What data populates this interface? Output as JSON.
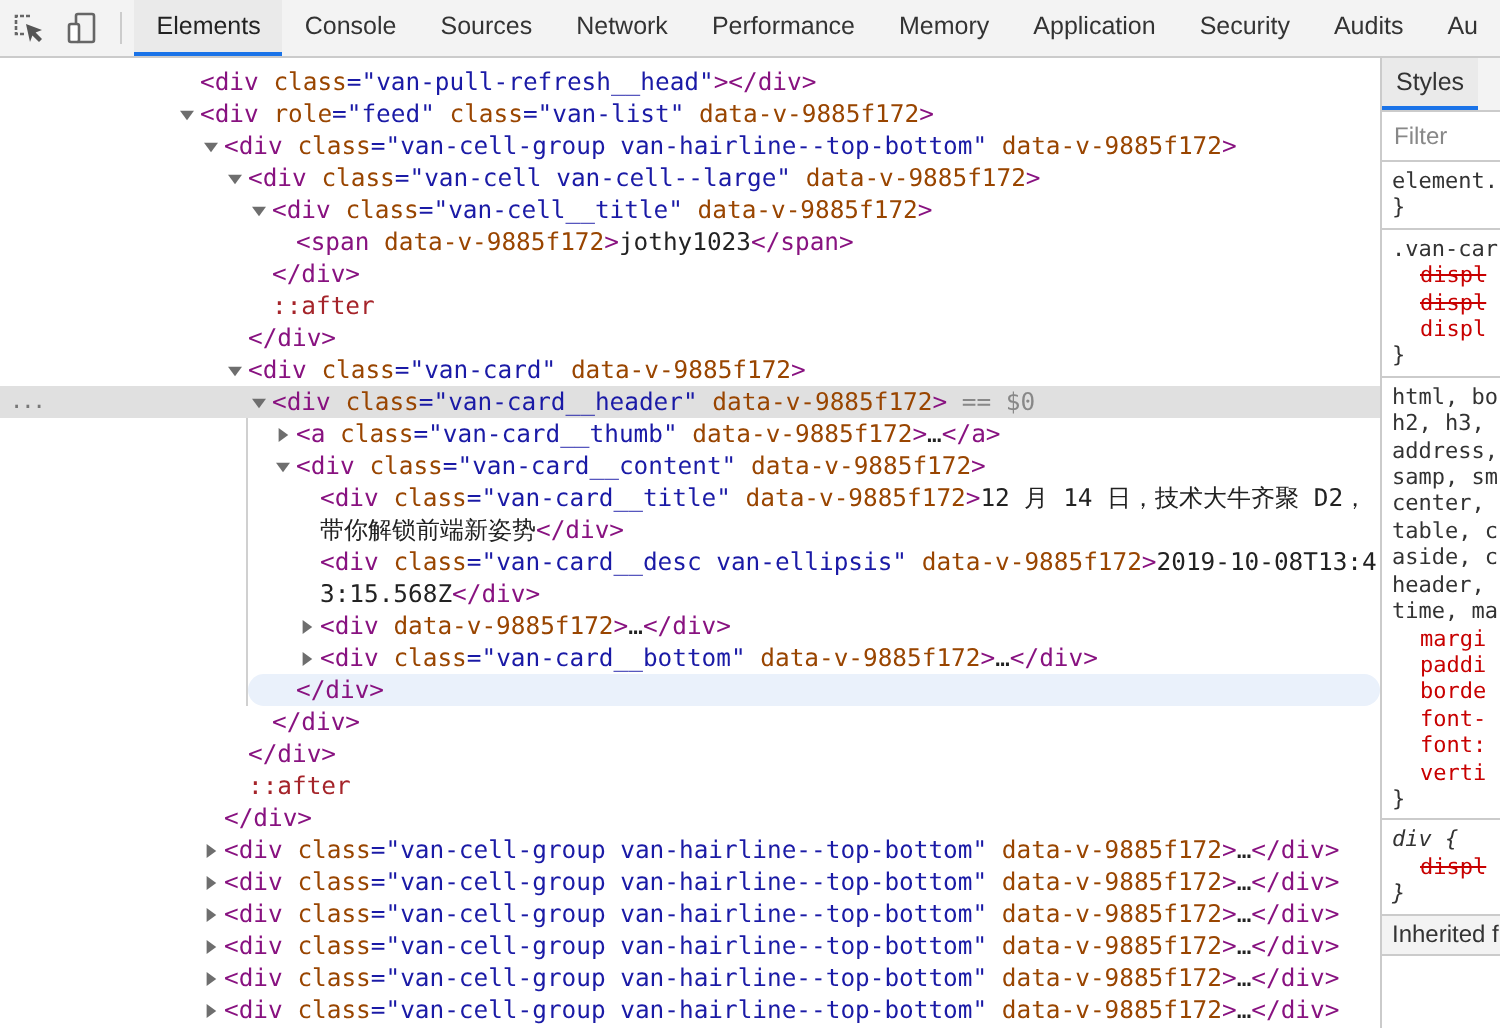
{
  "toolbar": {
    "tabs": [
      {
        "label": "Elements",
        "selected": true
      },
      {
        "label": "Console",
        "selected": false
      },
      {
        "label": "Sources",
        "selected": false
      },
      {
        "label": "Network",
        "selected": false
      },
      {
        "label": "Performance",
        "selected": false
      },
      {
        "label": "Memory",
        "selected": false
      },
      {
        "label": "Application",
        "selected": false
      },
      {
        "label": "Security",
        "selected": false
      },
      {
        "label": "Audits",
        "selected": false
      },
      {
        "label": "Au",
        "selected": false
      }
    ]
  },
  "elements": {
    "selected_marker": "...",
    "selected_suffix": " == $0",
    "nodes": [
      {
        "selected": false,
        "line": [
          {
            "kind": "tag",
            "text": "<div"
          },
          {
            "kind": "attr",
            "text": " class"
          },
          {
            "kind": "val",
            "text": "=\"van-pull-refresh__head\""
          },
          {
            "kind": "tag",
            "text": "></div>"
          }
        ]
      },
      {
        "selected": false,
        "expanded": true,
        "line": [
          {
            "kind": "tag",
            "text": "<div"
          },
          {
            "kind": "attr",
            "text": " role"
          },
          {
            "kind": "val",
            "text": "=\"feed\""
          },
          {
            "kind": "attr",
            "text": " class"
          },
          {
            "kind": "val",
            "text": "=\"van-list\""
          },
          {
            "kind": "attr",
            "text": " data-v-9885f172"
          },
          {
            "kind": "tag",
            "text": ">"
          }
        ],
        "children": [
          {
            "selected": false,
            "expanded": true,
            "line": [
              {
                "kind": "tag",
                "text": "<div"
              },
              {
                "kind": "attr",
                "text": " class"
              },
              {
                "kind": "val",
                "text": "=\"van-cell-group van-hairline--top-bottom\""
              },
              {
                "kind": "attr",
                "text": " data-v-9885f172"
              },
              {
                "kind": "tag",
                "text": ">"
              }
            ],
            "children": [
              {
                "selected": false,
                "expanded": true,
                "line": [
                  {
                    "kind": "tag",
                    "text": "<div"
                  },
                  {
                    "kind": "attr",
                    "text": " class"
                  },
                  {
                    "kind": "val",
                    "text": "=\"van-cell van-cell--large\""
                  },
                  {
                    "kind": "attr",
                    "text": " data-v-9885f172"
                  },
                  {
                    "kind": "tag",
                    "text": ">"
                  }
                ],
                "children": [
                  {
                    "selected": false,
                    "expanded": true,
                    "line": [
                      {
                        "kind": "tag",
                        "text": "<div"
                      },
                      {
                        "kind": "attr",
                        "text": " class"
                      },
                      {
                        "kind": "val",
                        "text": "=\"van-cell__title\""
                      },
                      {
                        "kind": "attr",
                        "text": " data-v-9885f172"
                      },
                      {
                        "kind": "tag",
                        "text": ">"
                      }
                    ],
                    "children": [
                      {
                        "selected": false,
                        "line": [
                          {
                            "kind": "tag",
                            "text": "<span"
                          },
                          {
                            "kind": "attr",
                            "text": " data-v-9885f172"
                          },
                          {
                            "kind": "tag",
                            "text": ">"
                          },
                          {
                            "kind": "text",
                            "text": "jothy1023"
                          },
                          {
                            "kind": "tag",
                            "text": "</span>"
                          }
                        ]
                      }
                    ],
                    "close": {
                      "hovered": false,
                      "line": [
                        {
                          "kind": "tag",
                          "text": "</div>"
                        }
                      ]
                    }
                  },
                  {
                    "selected": false,
                    "line": [
                      {
                        "kind": "pseudo",
                        "text": "::after"
                      }
                    ]
                  }
                ],
                "close": {
                  "hovered": false,
                  "line": [
                    {
                      "kind": "tag",
                      "text": "</div>"
                    }
                  ]
                }
              },
              {
                "selected": false,
                "expanded": true,
                "line": [
                  {
                    "kind": "tag",
                    "text": "<div"
                  },
                  {
                    "kind": "attr",
                    "text": " class"
                  },
                  {
                    "kind": "val",
                    "text": "=\"van-card\""
                  },
                  {
                    "kind": "attr",
                    "text": " data-v-9885f172"
                  },
                  {
                    "kind": "tag",
                    "text": ">"
                  }
                ],
                "children": [
                  {
                    "selected": true,
                    "expanded": true,
                    "line": [
                      {
                        "kind": "tag",
                        "text": "<div"
                      },
                      {
                        "kind": "attr",
                        "text": " class"
                      },
                      {
                        "kind": "val",
                        "text": "=\"van-card__header\""
                      },
                      {
                        "kind": "attr",
                        "text": " data-v-9885f172"
                      },
                      {
                        "kind": "tag",
                        "text": ">"
                      }
                    ],
                    "children": [
                      {
                        "selected": false,
                        "expanded": false,
                        "line": [
                          {
                            "kind": "tag",
                            "text": "<a"
                          },
                          {
                            "kind": "attr",
                            "text": " class"
                          },
                          {
                            "kind": "val",
                            "text": "=\"van-card__thumb\""
                          },
                          {
                            "kind": "attr",
                            "text": " data-v-9885f172"
                          },
                          {
                            "kind": "tag",
                            "text": ">"
                          },
                          {
                            "kind": "text",
                            "text": "…"
                          },
                          {
                            "kind": "tag",
                            "text": "</a>"
                          }
                        ]
                      },
                      {
                        "selected": false,
                        "expanded": true,
                        "line": [
                          {
                            "kind": "tag",
                            "text": "<div"
                          },
                          {
                            "kind": "attr",
                            "text": " class"
                          },
                          {
                            "kind": "val",
                            "text": "=\"van-card__content\""
                          },
                          {
                            "kind": "attr",
                            "text": " data-v-9885f172"
                          },
                          {
                            "kind": "tag",
                            "text": ">"
                          }
                        ],
                        "children": [
                          {
                            "selected": false,
                            "line": [
                              {
                                "kind": "tag",
                                "text": "<div"
                              },
                              {
                                "kind": "attr",
                                "text": " class"
                              },
                              {
                                "kind": "val",
                                "text": "=\"van-card__title\""
                              },
                              {
                                "kind": "attr",
                                "text": " data-v-9885f172"
                              },
                              {
                                "kind": "tag",
                                "text": ">"
                              },
                              {
                                "kind": "text",
                                "text": "12 月 14 日，技术大牛齐聚 D2，带你解锁前端新姿势"
                              },
                              {
                                "kind": "tag",
                                "text": "</div>"
                              }
                            ]
                          },
                          {
                            "selected": false,
                            "line": [
                              {
                                "kind": "tag",
                                "text": "<div"
                              },
                              {
                                "kind": "attr",
                                "text": " class"
                              },
                              {
                                "kind": "val",
                                "text": "=\"van-card__desc van-ellipsis\""
                              },
                              {
                                "kind": "attr",
                                "text": " data-v-9885f172"
                              },
                              {
                                "kind": "tag",
                                "text": ">"
                              },
                              {
                                "kind": "text",
                                "text": "2019-10-08T13:43:15.568Z"
                              },
                              {
                                "kind": "tag",
                                "text": "</div>"
                              }
                            ]
                          },
                          {
                            "selected": false,
                            "expanded": false,
                            "line": [
                              {
                                "kind": "tag",
                                "text": "<div"
                              },
                              {
                                "kind": "attr",
                                "text": " data-v-9885f172"
                              },
                              {
                                "kind": "tag",
                                "text": ">"
                              },
                              {
                                "kind": "text",
                                "text": "…"
                              },
                              {
                                "kind": "tag",
                                "text": "</div>"
                              }
                            ]
                          },
                          {
                            "selected": false,
                            "expanded": false,
                            "line": [
                              {
                                "kind": "tag",
                                "text": "<div"
                              },
                              {
                                "kind": "attr",
                                "text": " class"
                              },
                              {
                                "kind": "val",
                                "text": "=\"van-card__bottom\""
                              },
                              {
                                "kind": "attr",
                                "text": " data-v-9885f172"
                              },
                              {
                                "kind": "tag",
                                "text": ">"
                              },
                              {
                                "kind": "text",
                                "text": "…"
                              },
                              {
                                "kind": "tag",
                                "text": "</div>"
                              }
                            ]
                          }
                        ],
                        "close": {
                          "hovered": true,
                          "line": [
                            {
                              "kind": "tag",
                              "text": "</div>"
                            }
                          ]
                        }
                      }
                    ],
                    "close": {
                      "hovered": false,
                      "line": [
                        {
                          "kind": "tag",
                          "text": "</div>"
                        }
                      ]
                    }
                  }
                ],
                "close": {
                  "hovered": false,
                  "line": [
                    {
                      "kind": "tag",
                      "text": "</div>"
                    }
                  ]
                }
              },
              {
                "selected": false,
                "line": [
                  {
                    "kind": "pseudo",
                    "text": "::after"
                  }
                ]
              }
            ],
            "close": {
              "hovered": false,
              "line": [
                {
                  "kind": "tag",
                  "text": "</div>"
                }
              ]
            }
          },
          {
            "selected": false,
            "expanded": false,
            "line": [
              {
                "kind": "tag",
                "text": "<div"
              },
              {
                "kind": "attr",
                "text": " class"
              },
              {
                "kind": "val",
                "text": "=\"van-cell-group van-hairline--top-bottom\""
              },
              {
                "kind": "attr",
                "text": " data-v-9885f172"
              },
              {
                "kind": "tag",
                "text": ">"
              },
              {
                "kind": "text",
                "text": "…"
              },
              {
                "kind": "tag",
                "text": "</div>"
              }
            ]
          },
          {
            "selected": false,
            "expanded": false,
            "line": [
              {
                "kind": "tag",
                "text": "<div"
              },
              {
                "kind": "attr",
                "text": " class"
              },
              {
                "kind": "val",
                "text": "=\"van-cell-group van-hairline--top-bottom\""
              },
              {
                "kind": "attr",
                "text": " data-v-9885f172"
              },
              {
                "kind": "tag",
                "text": ">"
              },
              {
                "kind": "text",
                "text": "…"
              },
              {
                "kind": "tag",
                "text": "</div>"
              }
            ]
          },
          {
            "selected": false,
            "expanded": false,
            "line": [
              {
                "kind": "tag",
                "text": "<div"
              },
              {
                "kind": "attr",
                "text": " class"
              },
              {
                "kind": "val",
                "text": "=\"van-cell-group van-hairline--top-bottom\""
              },
              {
                "kind": "attr",
                "text": " data-v-9885f172"
              },
              {
                "kind": "tag",
                "text": ">"
              },
              {
                "kind": "text",
                "text": "…"
              },
              {
                "kind": "tag",
                "text": "</div>"
              }
            ]
          },
          {
            "selected": false,
            "expanded": false,
            "line": [
              {
                "kind": "tag",
                "text": "<div"
              },
              {
                "kind": "attr",
                "text": " class"
              },
              {
                "kind": "val",
                "text": "=\"van-cell-group van-hairline--top-bottom\""
              },
              {
                "kind": "attr",
                "text": " data-v-9885f172"
              },
              {
                "kind": "tag",
                "text": ">"
              },
              {
                "kind": "text",
                "text": "…"
              },
              {
                "kind": "tag",
                "text": "</div>"
              }
            ]
          },
          {
            "selected": false,
            "expanded": false,
            "line": [
              {
                "kind": "tag",
                "text": "<div"
              },
              {
                "kind": "attr",
                "text": " class"
              },
              {
                "kind": "val",
                "text": "=\"van-cell-group van-hairline--top-bottom\""
              },
              {
                "kind": "attr",
                "text": " data-v-9885f172"
              },
              {
                "kind": "tag",
                "text": ">"
              },
              {
                "kind": "text",
                "text": "…"
              },
              {
                "kind": "tag",
                "text": "</div>"
              }
            ]
          },
          {
            "selected": false,
            "expanded": false,
            "line": [
              {
                "kind": "tag",
                "text": "<div"
              },
              {
                "kind": "attr",
                "text": " class"
              },
              {
                "kind": "val",
                "text": "=\"van-cell-group van-hairline--top-bottom\""
              },
              {
                "kind": "attr",
                "text": " data-v-9885f172"
              },
              {
                "kind": "tag",
                "text": ">"
              },
              {
                "kind": "text",
                "text": "…"
              },
              {
                "kind": "tag",
                "text": "</div>"
              }
            ]
          }
        ]
      }
    ]
  },
  "styles": {
    "tabs": [
      {
        "label": "Styles",
        "selected": true
      }
    ],
    "filter": {
      "placeholder": "Filter"
    },
    "rules": [
      {
        "user_agent": false,
        "lines": [
          {
            "kind": "selector",
            "text": "element."
          },
          {
            "kind": "brace",
            "text": "}"
          }
        ]
      },
      {
        "user_agent": false,
        "lines": [
          {
            "kind": "selector",
            "text": ".van-car"
          },
          {
            "kind": "struck",
            "text": "displ"
          },
          {
            "kind": "struck",
            "text": "displ"
          },
          {
            "kind": "prop",
            "text": "displ"
          },
          {
            "kind": "brace",
            "text": "}"
          }
        ]
      },
      {
        "user_agent": false,
        "lines": [
          {
            "kind": "selector",
            "text": "html, bo"
          },
          {
            "kind": "selector",
            "text": "h2, h3,"
          },
          {
            "kind": "selector",
            "text": "address,"
          },
          {
            "kind": "selector",
            "text": "samp, sm"
          },
          {
            "kind": "selector",
            "text": "center,"
          },
          {
            "kind": "selector",
            "text": "table, c"
          },
          {
            "kind": "selector",
            "text": "aside, c"
          },
          {
            "kind": "selector",
            "text": "header,"
          },
          {
            "kind": "selector",
            "text": "time, ma"
          },
          {
            "kind": "prop",
            "text": "margi"
          },
          {
            "kind": "prop",
            "text": "paddi"
          },
          {
            "kind": "prop",
            "text": "borde"
          },
          {
            "kind": "prop",
            "text": "font-"
          },
          {
            "kind": "prop",
            "text": "font:"
          },
          {
            "kind": "prop",
            "text": "verti"
          },
          {
            "kind": "brace",
            "text": "}"
          }
        ]
      },
      {
        "user_agent": true,
        "lines": [
          {
            "kind": "selector",
            "text": "div {"
          },
          {
            "kind": "struck",
            "text": "displ"
          },
          {
            "kind": "brace",
            "text": "}"
          }
        ]
      }
    ],
    "section": "Inherited f"
  }
}
